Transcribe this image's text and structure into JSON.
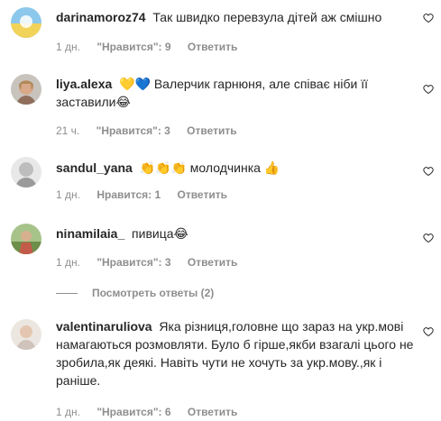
{
  "comments": [
    {
      "username": "darinamoroz74",
      "text": "Так швидко перевзула дітей аж смішно",
      "time": "1 дн.",
      "likes": "\"Нравится\": 9",
      "reply": "Ответить",
      "avatar_color": "#58a8d8"
    },
    {
      "username": "liya.alexa",
      "text": "💛💙 Валерчик гарнюня, але співає ніби її заставили😂",
      "time": "21 ч.",
      "likes": "\"Нравится\": 3",
      "reply": "Ответить",
      "avatar_color": "#c9a48f"
    },
    {
      "username": "sandul_yana",
      "text": "👏👏👏 молодчинка 👍",
      "time": "1 дн.",
      "likes": "Нравится: 1",
      "reply": "Ответить",
      "avatar_color": "#b9b9b9"
    },
    {
      "username": "ninamilaia_",
      "text": "пивица😂",
      "time": "1 дн.",
      "likes": "\"Нравится\": 3",
      "reply": "Ответить",
      "avatar_color": "#7a9a5a"
    },
    {
      "username": "valentinaruliova",
      "text": "Яка різниця,головне що зараз на укр.мові намагаються розмовляти. Було б гірше,якби взагалі цього не зробила,як деякі. Навіть чути не хочуть за укр.мову.,як і раніше.",
      "time": "1 дн.",
      "likes": "\"Нравится\": 6",
      "reply": "Ответить",
      "avatar_color": "#d8cfc8"
    }
  ],
  "view_replies": "Посмотреть ответы (2)"
}
